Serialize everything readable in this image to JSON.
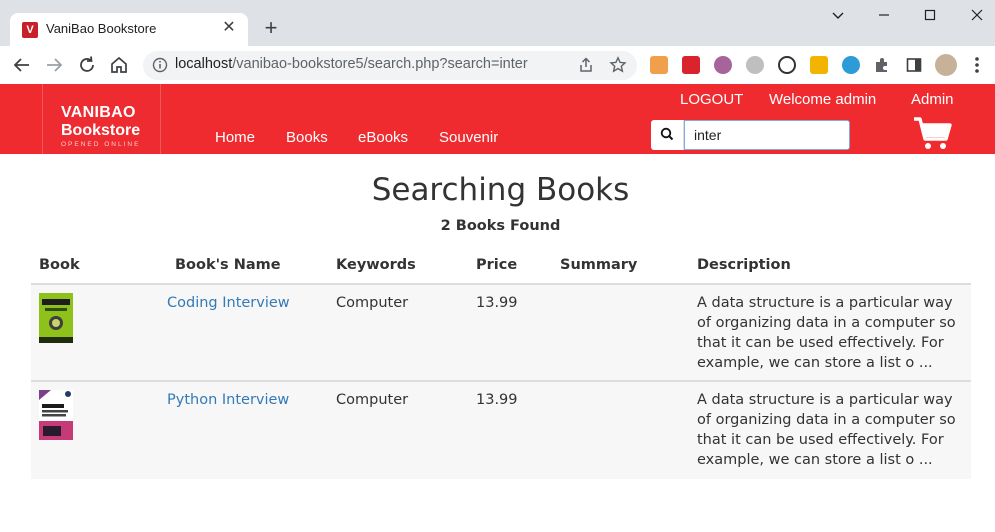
{
  "browser": {
    "tab_title": "VaniBao Bookstore",
    "tab_favicon_letter": "V",
    "url_host": "localhost",
    "url_path": "/vanibao-bookstore5/search.php?search=inter"
  },
  "site": {
    "logo": {
      "line1": "VANIBAO",
      "line2": "Bookstore",
      "tagline": "OPENED ONLINE"
    },
    "nav": [
      "Home",
      "Books",
      "eBooks",
      "Souvenir"
    ],
    "top_links": {
      "logout": "LOGOUT",
      "welcome": "Welcome admin",
      "admin": "Admin"
    },
    "search": {
      "value": "inter"
    },
    "accent_color": "#ef2b30"
  },
  "content": {
    "title": "Searching Books",
    "found": "2 Books Found",
    "columns": [
      "Book",
      "Book's Name",
      "Keywords",
      "Price",
      "Summary",
      "Description"
    ],
    "rows": [
      {
        "name": "Coding Interview",
        "keywords": "Computer",
        "price": "13.99",
        "summary": "",
        "description": "A data structure is a particular way of organizing data in a computer so that it can be used effectively. For example, we can store a list o ..."
      },
      {
        "name": "Python Interview",
        "keywords": "Computer",
        "price": "13.99",
        "summary": "",
        "description": "A data structure is a particular way of organizing data in a computer so that it can be used effectively. For example, we can store a list o ..."
      }
    ]
  }
}
